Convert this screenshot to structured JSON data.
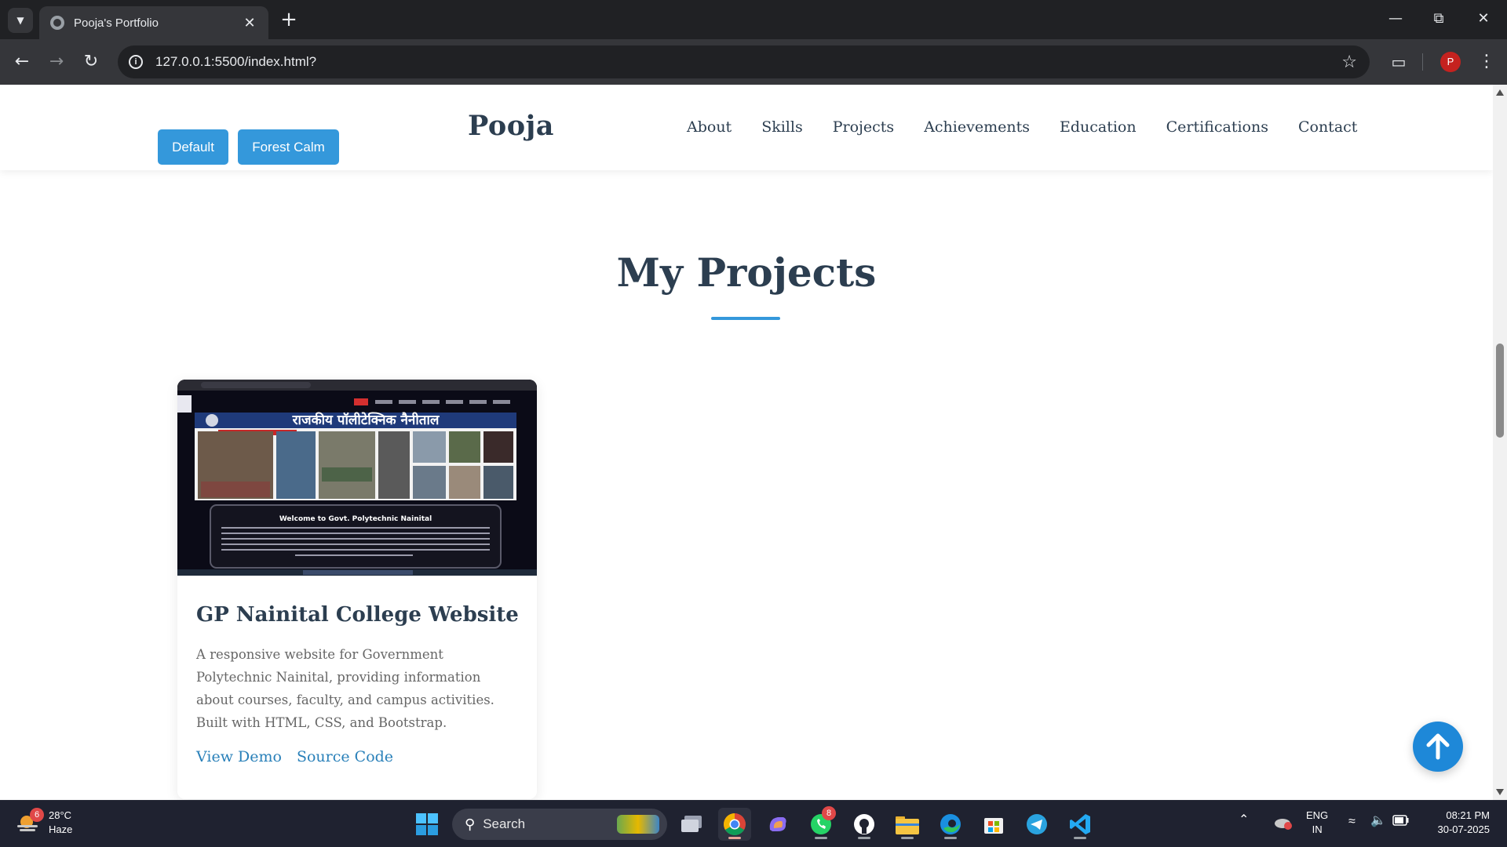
{
  "browser": {
    "tab_title": "Pooja's Portfolio",
    "url": "127.0.0.1:5500/index.html?",
    "profile_initial": "P"
  },
  "header": {
    "theme_buttons": [
      "Default",
      "Forest Calm"
    ],
    "logo": "Pooja",
    "nav": [
      "About",
      "Skills",
      "Projects",
      "Achievements",
      "Education",
      "Certifications",
      "Contact"
    ]
  },
  "projects": {
    "section_title": "My Projects",
    "cards": [
      {
        "title": "GP Nainital College Website",
        "description": "A responsive website for Government Polytechnic Nainital, providing information about courses, faculty, and campus activities. Built with HTML, CSS, and Bootstrap.",
        "links": [
          "View Demo",
          "Source Code"
        ],
        "thumbnail": {
          "banner_text": "राजकीय पॉलीटेक्निक नैनीताल",
          "welcome_text": "Welcome to Govt. Polytechnic Nainital"
        }
      }
    ]
  },
  "taskbar": {
    "weather_temp": "28°C",
    "weather_desc": "Haze",
    "weather_badge": "6",
    "search_label": "Search",
    "whatsapp_badge": "8",
    "language_top": "ENG",
    "language_bottom": "IN",
    "time": "08:21 PM",
    "date": "30-07-2025"
  },
  "colors": {
    "accent": "#3498db",
    "heading": "#2c3e50",
    "link": "#2980b9"
  }
}
